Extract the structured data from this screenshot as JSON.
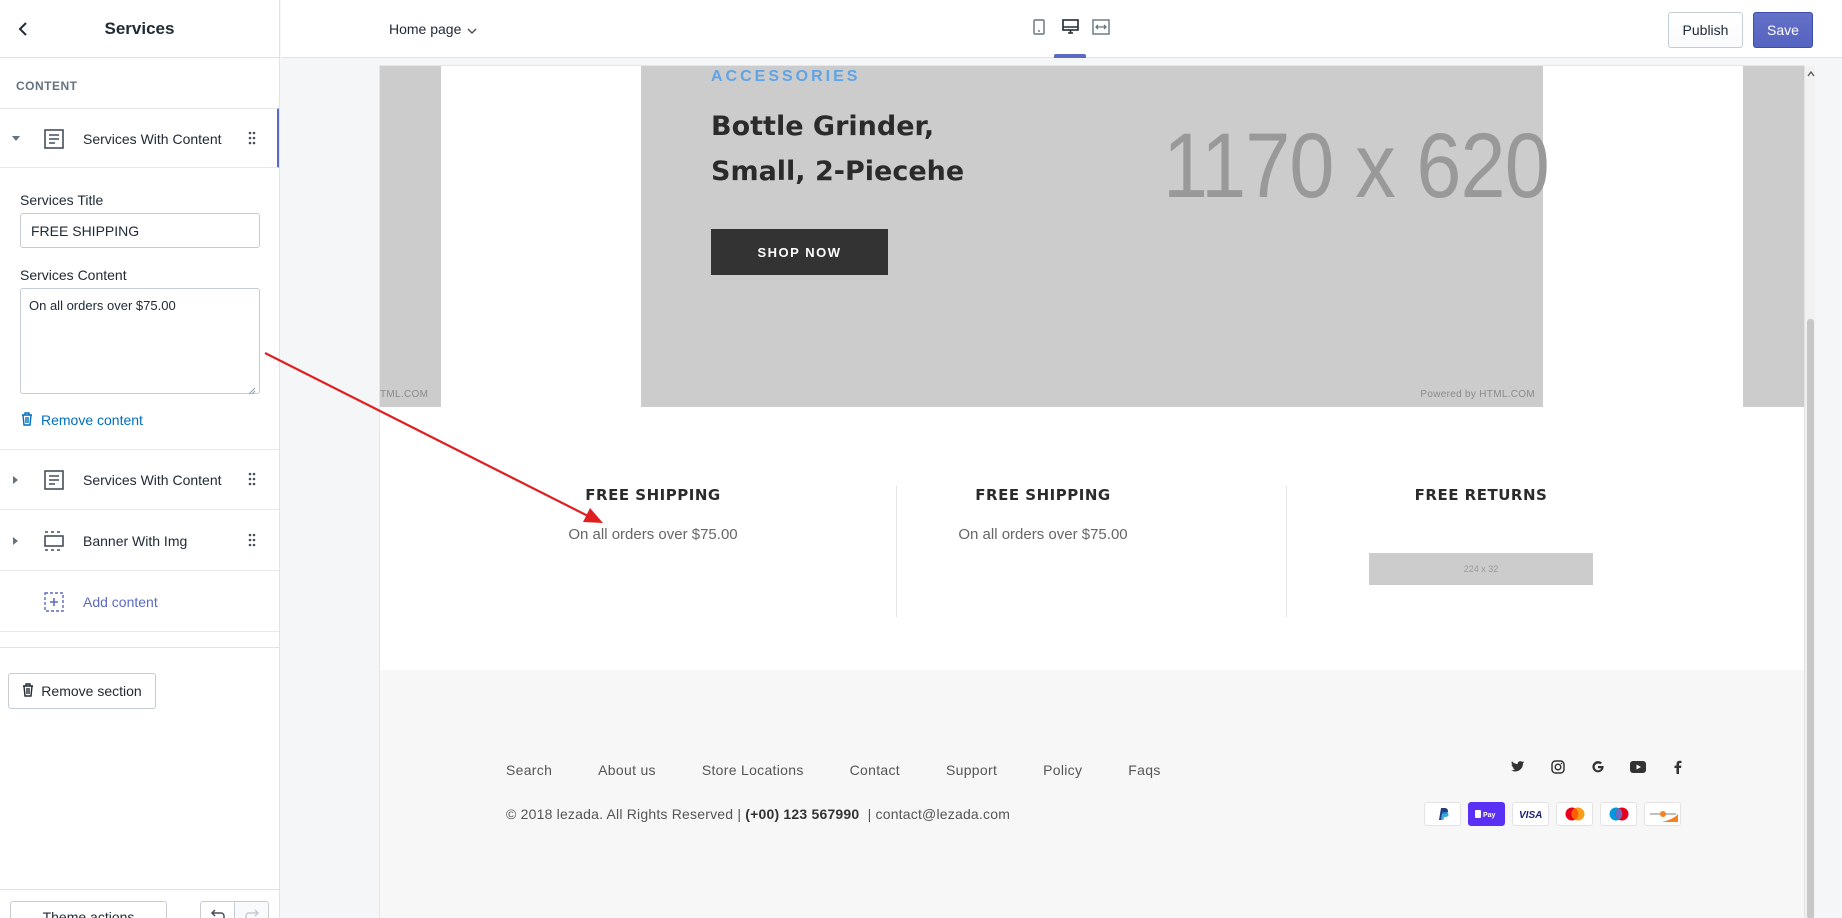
{
  "sidebar": {
    "title": "Services",
    "section_label": "CONTENT",
    "blocks": [
      {
        "label": "Services With Content"
      },
      {
        "label": "Services With Content"
      },
      {
        "label": "Banner With Img"
      }
    ],
    "fields": {
      "title_label": "Services Title",
      "title_value": "FREE SHIPPING",
      "content_label": "Services Content",
      "content_value": "On all orders over $75.00"
    },
    "remove_content": "Remove content",
    "add_content": "Add content",
    "remove_section": "Remove section",
    "theme_actions": "Theme actions"
  },
  "topbar": {
    "page_select": "Home page",
    "publish": "Publish",
    "save": "Save",
    "viewports": [
      "mobile-icon",
      "desktop-icon",
      "fullscreen-icon"
    ]
  },
  "preview": {
    "banner": {
      "category": "ACCESSORIES",
      "title_line1": "Bottle Grinder,",
      "title_line2": "Small, 2-Piecehe",
      "button": "SHOP NOW",
      "placeholder_size": "1170 x 620",
      "placeholder_left": "TML.COM",
      "powered_by": "Powered by HTML.COM"
    },
    "services": [
      {
        "title": "FREE SHIPPING",
        "text": "On all orders over $75.00"
      },
      {
        "title": "FREE SHIPPING",
        "text": "On all orders over $75.00"
      },
      {
        "title": "FREE RETURNS",
        "image_text": "224 x 32"
      }
    ],
    "footer": {
      "links": [
        "Search",
        "About us",
        "Store Locations",
        "Contact",
        "Support",
        "Policy",
        "Faqs"
      ],
      "copyright_prefix": "© 2018 lezada. All Rights Reserved | ",
      "phone": "(+00) 123 567990",
      "email_part": "  | contact@lezada.com",
      "socials": [
        "twitter-icon",
        "instagram-icon",
        "google-icon",
        "youtube-icon",
        "facebook-icon"
      ],
      "payments": [
        "PayPal",
        "Apple Pay",
        "VISA",
        "Mastercard",
        "Maestro",
        "Discover"
      ]
    }
  },
  "colors": {
    "accent": "#5c6ac4",
    "link": "#006fbb",
    "category": "#5ea4e6",
    "shop_button": "#333333",
    "annotation_arrow": "#e02020"
  }
}
